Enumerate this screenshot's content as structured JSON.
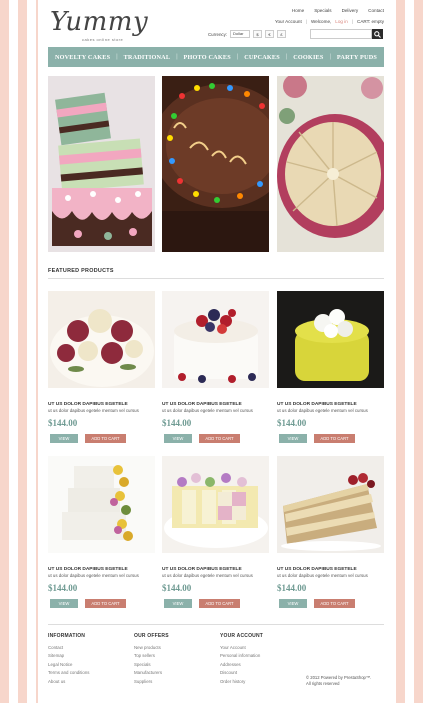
{
  "header": {
    "logo": "Yummy",
    "tagline": "cakes online store",
    "toplinks": [
      "Home",
      "Specials",
      "Delivery",
      "Contact"
    ],
    "account": {
      "your_account": "Your Account",
      "welcome": "Welcome,",
      "login": "Log in",
      "cart": "CART: empty"
    },
    "currency": {
      "label": "Currency:",
      "selected": "Dollar",
      "buttons": [
        "$",
        "€",
        "£"
      ]
    },
    "search": {
      "placeholder": ""
    }
  },
  "nav": [
    "NOVELTY CAKES",
    "TRADITIONAL",
    "PHOTO CAKES",
    "CUPCAKES",
    "COOKIES",
    "PARTY PUDS"
  ],
  "featured": {
    "title": "FEATURED PRODUCTS",
    "products": [
      {
        "name": "UT US DOLOR DAPIBUS EGETELE",
        "desc": "ut us dolor dapibus egetele mentum vel cursus",
        "price": "$144.00",
        "view": "VIEW",
        "cart": "ADD TO CART"
      },
      {
        "name": "UT US DOLOR DAPIBUS EGETELE",
        "desc": "ut us dolor dapibus egetele mentum vel cursus",
        "price": "$144.00",
        "view": "VIEW",
        "cart": "ADD TO CART"
      },
      {
        "name": "UT US DOLOR DAPIBUS EGETELE",
        "desc": "ut us dolor dapibus egetele mentum vel cursus",
        "price": "$144.00",
        "view": "VIEW",
        "cart": "ADD TO CART"
      },
      {
        "name": "UT US DOLOR DAPIBUS EGETELE",
        "desc": "ut us dolor dapibus egetele mentum vel cursus",
        "price": "$144.00",
        "view": "VIEW",
        "cart": "ADD TO CART"
      },
      {
        "name": "UT US DOLOR DAPIBUS EGETELE",
        "desc": "ut us dolor dapibus egetele mentum vel cursus",
        "price": "$144.00",
        "view": "VIEW",
        "cart": "ADD TO CART"
      },
      {
        "name": "UT US DOLOR DAPIBUS EGETELE",
        "desc": "ut us dolor dapibus egetele mentum vel cursus",
        "price": "$144.00",
        "view": "VIEW",
        "cart": "ADD TO CART"
      }
    ]
  },
  "footer": {
    "information": {
      "title": "INFORMATION",
      "links": [
        "Contact",
        "Sitemap",
        "Legal Notice",
        "Terms and conditions",
        "About us"
      ]
    },
    "offers": {
      "title": "OUR OFFERS",
      "links": [
        "New products",
        "Top sellers",
        "Specials",
        "Manufacturers",
        "Suppliers"
      ]
    },
    "account": {
      "title": "YOUR ACCOUNT",
      "links": [
        "Your Account",
        "Personal information",
        "Addresses",
        "Discount",
        "Order history"
      ]
    },
    "copyright": [
      "© 2012 Powered by PrestaShop™.",
      "All rights reserved"
    ]
  },
  "colors": {
    "accent": "#8bb1aa",
    "cart_button": "#c97e70",
    "stripe": "#f7d6cb",
    "price": "#6e9a92"
  }
}
